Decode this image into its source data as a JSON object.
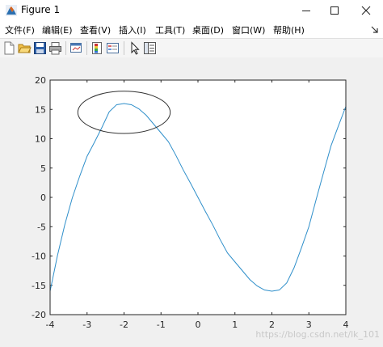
{
  "window": {
    "title": "Figure 1",
    "minimize_icon": "minimize-icon",
    "maximize_icon": "maximize-icon",
    "close_icon": "close-icon"
  },
  "menu": {
    "items": [
      {
        "label": "文件(F)"
      },
      {
        "label": "编辑(E)"
      },
      {
        "label": "查看(V)"
      },
      {
        "label": "插入(I)"
      },
      {
        "label": "工具(T)"
      },
      {
        "label": "桌面(D)"
      },
      {
        "label": "窗口(W)"
      },
      {
        "label": "帮助(H)"
      }
    ],
    "dock_icon": "dock-arrow-icon"
  },
  "toolbar": {
    "buttons": [
      {
        "icon": "new-figure-icon"
      },
      {
        "icon": "open-file-icon"
      },
      {
        "icon": "save-icon"
      },
      {
        "icon": "print-icon"
      },
      {
        "icon": "link-plot-icon"
      },
      {
        "icon": "colorbar-icon"
      },
      {
        "icon": "legend-icon"
      },
      {
        "icon": "edit-plot-arrow-icon"
      },
      {
        "icon": "property-inspector-icon"
      }
    ]
  },
  "watermark": "https://blog.csdn.net/lk_101",
  "chart_data": {
    "type": "line",
    "title": "",
    "xlabel": "",
    "ylabel": "",
    "xlim": [
      -4,
      4
    ],
    "ylim": [
      -20,
      20
    ],
    "xticks": [
      -4,
      -3,
      -2,
      -1,
      0,
      1,
      2,
      3,
      4
    ],
    "yticks": [
      -20,
      -15,
      -10,
      -5,
      0,
      5,
      10,
      15,
      20
    ],
    "grid": false,
    "series": [
      {
        "color": "#2f8fca",
        "x": [
          -4,
          -3.8,
          -3.6,
          -3.4,
          -3.2,
          -3,
          -2.8,
          -2.6,
          -2.4,
          -2.2,
          -2,
          -1.8,
          -1.6,
          -1.4,
          -1.2,
          -1,
          -0.8,
          -0.6,
          -0.4,
          -0.2,
          0,
          0.2,
          0.4,
          0.6,
          0.8,
          1,
          1.2,
          1.4,
          1.6,
          1.8,
          2,
          2.2,
          2.4,
          2.6,
          2.8,
          3,
          3.2,
          3.4,
          3.6,
          3.8,
          4
        ],
        "y": [
          -16,
          -9.9,
          -4.6,
          -0.1,
          3.6,
          7,
          9.4,
          11.9,
          14.6,
          15.8,
          16,
          15.8,
          15.1,
          14,
          12.5,
          11,
          9.5,
          7.2,
          4.7,
          2.4,
          0,
          -2.4,
          -4.7,
          -7.2,
          -9.5,
          -11,
          -12.5,
          -14,
          -15.1,
          -15.8,
          -16,
          -15.8,
          -14.6,
          -12,
          -8.6,
          -5,
          -0.3,
          4.3,
          8.8,
          12.2,
          15.5
        ]
      }
    ],
    "annotations": [
      {
        "type": "ellipse",
        "center": [
          -2,
          14.5
        ],
        "radius_x": 1.25,
        "radius_y": 3.6,
        "color": "#333333"
      }
    ]
  }
}
